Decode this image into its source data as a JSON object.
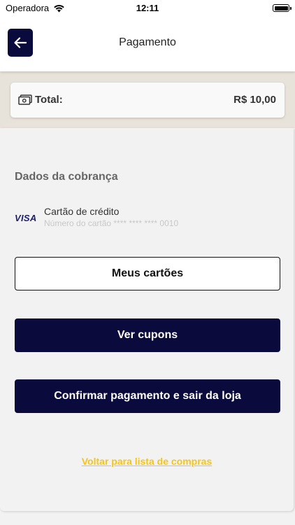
{
  "status_bar": {
    "carrier": "Operadora",
    "time": "12:11"
  },
  "header": {
    "title": "Pagamento",
    "back_icon": "arrow-left-icon"
  },
  "total": {
    "icon": "money-icon",
    "label": "Total:",
    "value": "R$ 10,00"
  },
  "billing": {
    "section_title": "Dados da cobrança",
    "card_brand": "VISA",
    "card_type": "Cartão de crédito",
    "card_number": "Número do cartão **** **** **** 0010"
  },
  "actions": {
    "my_cards": "Meus cartões",
    "coupons": "Ver cupons",
    "confirm": "Confirmar pagamento e sair da loja",
    "back_link": "Voltar para lista de compras"
  },
  "colors": {
    "primary": "#0a0a3d",
    "link": "#f5c518",
    "band": "#e8e3da"
  }
}
